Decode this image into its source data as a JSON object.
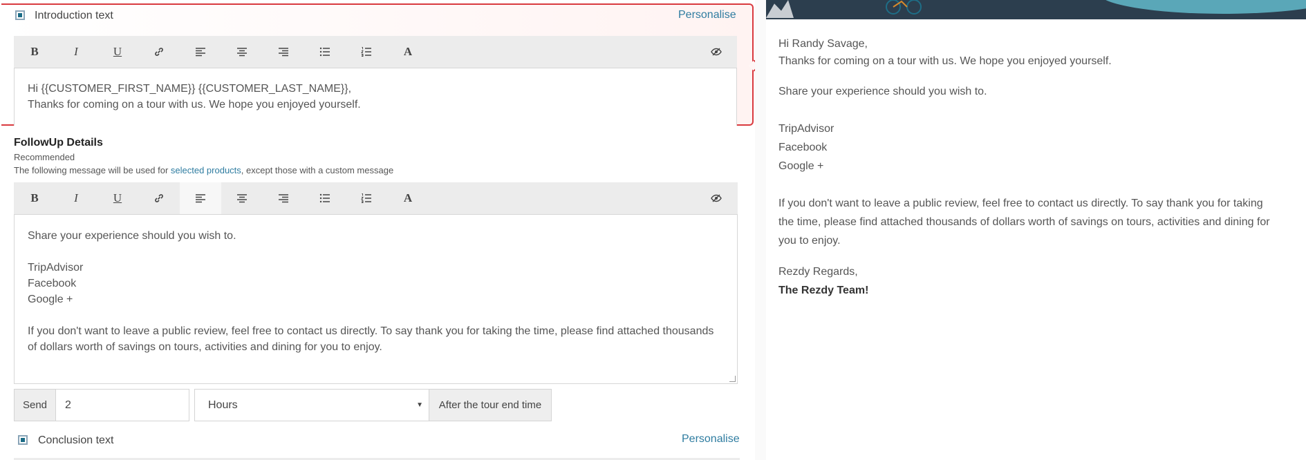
{
  "intro": {
    "label": "Introduction text",
    "personalise": "Personalise",
    "line1": "Hi {{CUSTOMER_FIRST_NAME}} {{CUSTOMER_LAST_NAME}},",
    "line2": "Thanks for coming on a tour with us. We hope you enjoyed yourself."
  },
  "toolbar": {
    "bold": "B",
    "italic": "I",
    "underline": "U",
    "font": "A"
  },
  "followup": {
    "title": "FollowUp Details",
    "recommended": "Recommended",
    "desc_pre": "The following message will be used for ",
    "desc_link": "selected products",
    "desc_post": ", except those with a custom message",
    "lines": [
      "Share your experience should you wish to.",
      "",
      "TripAdvisor",
      "Facebook",
      "Google +",
      "",
      "If you don't want to leave a public review, feel free to contact us directly. To say thank you for taking the time, please find attached thousands",
      "of dollars worth of savings on tours, activities and dining for you to enjoy."
    ]
  },
  "send": {
    "label": "Send",
    "value": "2",
    "unit": "Hours",
    "suffix": "After the tour end time"
  },
  "conclusion": {
    "label": "Conclusion text",
    "personalise": "Personalise"
  },
  "preview": {
    "greeting": "Hi Randy Savage,",
    "thanks": "Thanks for coming on a tour with us. We hope you enjoyed yourself.",
    "share": "Share your experience should you wish to.",
    "links": [
      "TripAdvisor",
      "Facebook",
      "Google +"
    ],
    "review1": "If you don't want to leave a public review, feel free to contact us directly. To say thank you for taking",
    "review2": "the time, please find attached thousands of dollars worth of savings on tours, activities and dining for",
    "review3": "you to enjoy.",
    "regards": "Rezdy Regards,",
    "team": "The Rezdy Team!"
  },
  "colors": {
    "accent": "#2e7ca0",
    "highlight_border": "#d9393e"
  }
}
